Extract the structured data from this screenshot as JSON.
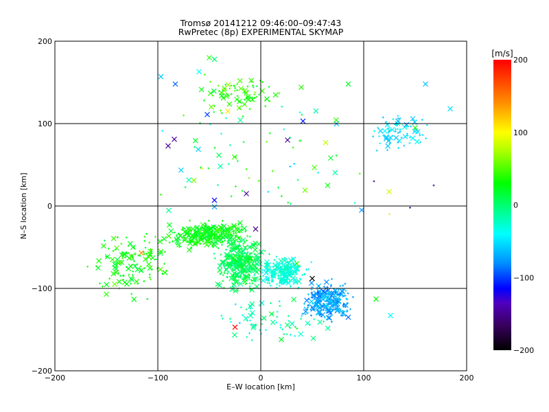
{
  "chart_data": {
    "type": "scatter",
    "title": "Tromsø 20141212 09:46:00–09:47:43",
    "subtitle": "RwPretec (8p) EXPERIMENTAL SKYMAP",
    "xlabel": "E–W location [km]",
    "ylabel": "N–S location [km]",
    "xlim": [
      -200,
      200
    ],
    "ylim": [
      -200,
      200
    ],
    "xticks": [
      "−200",
      "−100",
      "0",
      "100",
      "200"
    ],
    "yticks": [
      "−200",
      "−100",
      "0",
      "100",
      "200"
    ],
    "xtick_values": [
      -200,
      -100,
      0,
      100,
      200
    ],
    "ytick_values": [
      -200,
      -100,
      0,
      100,
      200
    ],
    "grid": true,
    "colorbar": {
      "label": "[m/s]",
      "range": [
        -200,
        200
      ],
      "ticks": [
        "200",
        "100",
        "0",
        "−100",
        "−200"
      ],
      "tick_values": [
        200,
        100,
        0,
        -100,
        -200
      ],
      "stops": [
        {
          "v": -200,
          "c": "#000000"
        },
        {
          "v": -165,
          "c": "#3a0060"
        },
        {
          "v": -135,
          "c": "#5000c0"
        },
        {
          "v": -115,
          "c": "#0000ff"
        },
        {
          "v": -80,
          "c": "#0090ff"
        },
        {
          "v": -40,
          "c": "#00ffff"
        },
        {
          "v": 0,
          "c": "#00ff70"
        },
        {
          "v": 30,
          "c": "#00ff00"
        },
        {
          "v": 75,
          "c": "#b0ff00"
        },
        {
          "v": 100,
          "c": "#ffff00"
        },
        {
          "v": 140,
          "c": "#ff9000"
        },
        {
          "v": 200,
          "c": "#ff0000"
        }
      ]
    },
    "clusters": [
      {
        "cx": -50,
        "cy": -35,
        "sx": 25,
        "sy": 10,
        "n": 320,
        "v": 25,
        "dv": 15
      },
      {
        "cx": -20,
        "cy": -70,
        "sx": 14,
        "sy": 20,
        "n": 360,
        "v": 8,
        "dv": 15
      },
      {
        "cx": 22,
        "cy": -80,
        "sx": 16,
        "sy": 12,
        "n": 200,
        "v": -30,
        "dv": 12
      },
      {
        "cx": 65,
        "cy": -115,
        "sx": 14,
        "sy": 14,
        "n": 260,
        "v": -72,
        "dv": 15
      },
      {
        "cx": -125,
        "cy": -65,
        "sx": 25,
        "sy": 25,
        "n": 130,
        "v": 30,
        "dv": 15
      },
      {
        "cx": 135,
        "cy": 90,
        "sx": 18,
        "sy": 14,
        "n": 80,
        "v": -50,
        "dv": 15
      },
      {
        "cx": -20,
        "cy": 135,
        "sx": 28,
        "sy": 15,
        "n": 80,
        "v": 35,
        "dv": 20
      },
      {
        "cx": 10,
        "cy": -140,
        "sx": 40,
        "sy": 18,
        "n": 70,
        "v": -15,
        "dv": 25
      },
      {
        "cx": 0,
        "cy": 60,
        "sx": 80,
        "sy": 50,
        "n": 70,
        "v": 10,
        "dv": 50
      }
    ],
    "points": [
      {
        "x": -25,
        "y": -147,
        "v": 200,
        "m": "x"
      },
      {
        "x": -90,
        "y": 73,
        "v": -150,
        "m": "x"
      },
      {
        "x": -84,
        "y": 81,
        "v": -145,
        "m": "x"
      },
      {
        "x": 26,
        "y": 80,
        "v": -150,
        "m": "x"
      },
      {
        "x": -45,
        "y": 7,
        "v": -115,
        "m": "x"
      },
      {
        "x": -14,
        "y": 15,
        "v": -150,
        "m": "x"
      },
      {
        "x": 50,
        "y": -88,
        "v": -200,
        "m": "x"
      },
      {
        "x": 41,
        "y": 103,
        "v": -110,
        "m": "x"
      },
      {
        "x": -52,
        "y": 111,
        "v": -100,
        "m": "x"
      },
      {
        "x": -97,
        "y": 157,
        "v": -60,
        "m": "x"
      },
      {
        "x": -83,
        "y": 148,
        "v": -90,
        "m": "x"
      },
      {
        "x": -60,
        "y": 163,
        "v": -40,
        "m": "x"
      },
      {
        "x": -65,
        "y": 31,
        "v": 60,
        "m": "x"
      },
      {
        "x": -32,
        "y": 115,
        "v": 110,
        "m": "x"
      },
      {
        "x": -116,
        "y": -57,
        "v": 140,
        "m": "x"
      },
      {
        "x": -5,
        "y": -28,
        "v": -150,
        "m": "x"
      },
      {
        "x": 98,
        "y": -5,
        "v": -80,
        "m": "x"
      },
      {
        "x": 110,
        "y": 30,
        "v": -150,
        "m": "+"
      },
      {
        "x": 160,
        "y": 148,
        "v": -60,
        "m": "x"
      },
      {
        "x": 184,
        "y": 118,
        "v": -50,
        "m": "x"
      },
      {
        "x": 150,
        "y": 95,
        "v": 40,
        "m": "x"
      },
      {
        "x": 126,
        "y": -133,
        "v": -40,
        "m": "x"
      },
      {
        "x": 112,
        "y": -113,
        "v": 30,
        "m": "x"
      },
      {
        "x": -158,
        "y": -75,
        "v": 20,
        "m": "x"
      },
      {
        "x": -150,
        "y": -107,
        "v": 40,
        "m": "x"
      },
      {
        "x": -45,
        "y": -1,
        "v": -70,
        "m": "x"
      },
      {
        "x": 85,
        "y": 148,
        "v": 20,
        "m": "x"
      },
      {
        "x": -50,
        "y": 180,
        "v": 40,
        "m": "x"
      },
      {
        "x": 20,
        "y": -162,
        "v": 20,
        "m": "x"
      },
      {
        "x": 85,
        "y": -135,
        "v": -90,
        "m": "x"
      },
      {
        "x": 65,
        "y": 25,
        "v": 30,
        "m": "x"
      },
      {
        "x": 125,
        "y": -10,
        "v": 110,
        "m": "+"
      },
      {
        "x": 145,
        "y": -2,
        "v": -150,
        "m": "+"
      },
      {
        "x": 168,
        "y": 25,
        "v": -150,
        "m": "+"
      },
      {
        "x": -45,
        "y": 178,
        "v": 0,
        "m": "x"
      },
      {
        "x": 35,
        "y": -70,
        "v": 40,
        "m": "x"
      }
    ]
  }
}
